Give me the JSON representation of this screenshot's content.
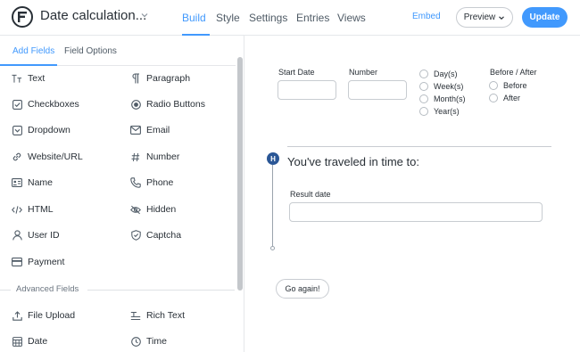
{
  "header": {
    "title": "Date calculation...",
    "tabs": [
      {
        "label": "Build"
      },
      {
        "label": "Style"
      },
      {
        "label": "Settings"
      },
      {
        "label": "Entries"
      },
      {
        "label": "Views"
      }
    ],
    "active_tab": "Build",
    "embed_label": "Embed",
    "preview_label": "Preview",
    "update_label": "Update",
    "accent_color": "#4199fd"
  },
  "sidebar": {
    "tabs": [
      {
        "label": "Add Fields"
      },
      {
        "label": "Field Options"
      }
    ],
    "fields": [
      {
        "label": "Text",
        "icon": "text-icon"
      },
      {
        "label": "Paragraph",
        "icon": "paragraph-icon"
      },
      {
        "label": "Checkboxes",
        "icon": "checkbox-icon"
      },
      {
        "label": "Radio Buttons",
        "icon": "radio-icon"
      },
      {
        "label": "Dropdown",
        "icon": "dropdown-icon"
      },
      {
        "label": "Email",
        "icon": "email-icon"
      },
      {
        "label": "Website/URL",
        "icon": "link-icon"
      },
      {
        "label": "Number",
        "icon": "hash-icon"
      },
      {
        "label": "Name",
        "icon": "id-card-icon"
      },
      {
        "label": "Phone",
        "icon": "phone-icon"
      },
      {
        "label": "HTML",
        "icon": "code-icon"
      },
      {
        "label": "Hidden",
        "icon": "eye-off-icon"
      },
      {
        "label": "User ID",
        "icon": "user-icon"
      },
      {
        "label": "Captcha",
        "icon": "shield-icon"
      },
      {
        "label": "Payment",
        "icon": "credit-card-icon"
      }
    ],
    "advanced_label": "Advanced Fields",
    "advanced_fields": [
      {
        "label": "File Upload",
        "icon": "upload-icon"
      },
      {
        "label": "Rich Text",
        "icon": "rich-text-icon"
      },
      {
        "label": "Date",
        "icon": "calendar-icon"
      },
      {
        "label": "Time",
        "icon": "clock-icon"
      }
    ]
  },
  "form": {
    "start_date_label": "Start Date",
    "start_date_value": "",
    "number_label": "Number",
    "number_value": "",
    "units": [
      "Day(s)",
      "Week(s)",
      "Month(s)",
      "Year(s)"
    ],
    "direction_label": "Before / After",
    "directions": [
      "Before",
      "After"
    ],
    "section_badge": "H",
    "section_title": "You've traveled in time to:",
    "result_label": "Result date",
    "result_value": "",
    "submit_label": "Go again!",
    "section_badge_color": "#2b5796"
  }
}
